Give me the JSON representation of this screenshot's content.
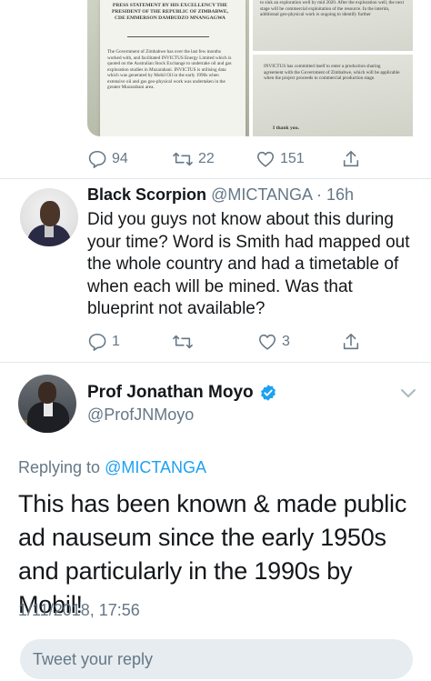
{
  "media": {
    "doc1": {
      "heading": "PRESS STATEMENT BY HIS EXCELLENCY THE PRESIDENT OF THE REPUBLIC OF ZIMBABWE, CDE EMMERSON DAMBUDZO MNANGAGWA",
      "body": "The Government of Zimbabwe has over the last few months worked with, and facilitated INVICTUS Energy Limited which is quoted on the Australian Stock Exchange to undertake oil and gas exploration studies in Muzarabani. INVICTUS is utilising data which was generated by Mobil Oil in the early 1990s when extensive oil and gas geo-physical work was undertaken in the greater Muzarabani area."
    },
    "doc2": {
      "text": "to sink an exploration well by mid 2020. After the exploration well, the next stage will be commercial exploitation of the resource. In the interim, additional geo-physical work is ongoing to identify further"
    },
    "doc3": {
      "text": "INVICTUS has committed itself to enter a production sharing agreement with the Government of Zimbabwe, which will be applicable when the project proceeds to commercial production stage.",
      "closing": "I thank you."
    }
  },
  "top_actions": {
    "replies": "94",
    "retweets": "22",
    "likes": "151"
  },
  "reply_tweet": {
    "name": "Black Scorpion",
    "handle": "@MICTANGA",
    "time": "· 16h",
    "text": "Did you guys not know about this during your time? Word is Smith had mapped out the whole country and had a timetable of when each will be mined. Was that blueprint not available?",
    "replies": "1",
    "retweets": "",
    "likes": "3"
  },
  "main_tweet": {
    "name": "Prof Jonathan Moyo",
    "handle": "@ProfJNMoyo",
    "replying_prefix": "Replying to ",
    "replying_to": "@MICTANGA",
    "text": "This has been known & made public ad nauseum since the early 1950s and particularly in the 1990s by Mobil!",
    "timestamp": "1/11/2018, 17:56"
  },
  "composer": {
    "placeholder": "Tweet your reply"
  },
  "colors": {
    "text": "#14171a",
    "secondary": "#657786",
    "link": "#1da1f2",
    "verified": "#1da1f2",
    "divider": "#e1e8ed",
    "composer_bg": "#e6ecf0"
  }
}
